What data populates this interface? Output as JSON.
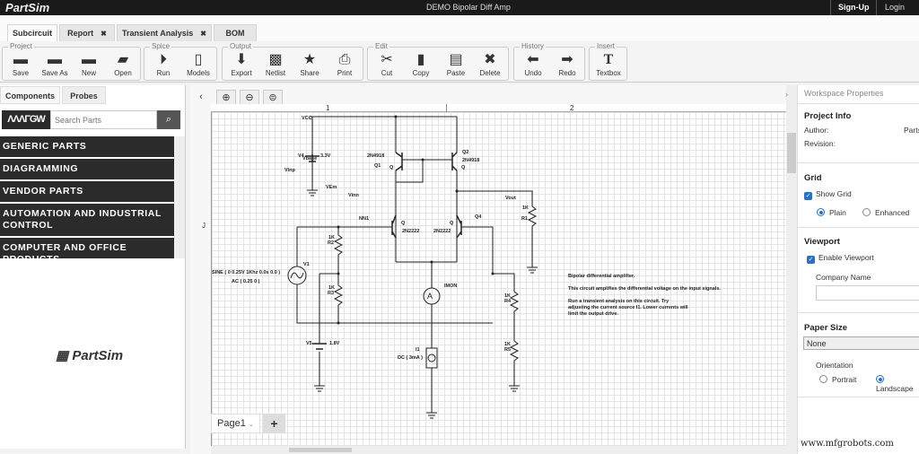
{
  "app": {
    "name": "PartSim",
    "title": "DEMO Bipolar Diff Amp",
    "signup": "Sign-Up",
    "login": "Login"
  },
  "tabs": [
    {
      "label": "Subcircuit",
      "active": true
    },
    {
      "label": "Report",
      "closable": true
    },
    {
      "label": "Transient Analysis",
      "closable": true
    },
    {
      "label": "BOM"
    }
  ],
  "toolbar": {
    "groups": [
      {
        "label": "Project",
        "items": [
          {
            "label": "Save",
            "icon": "folder-icon"
          },
          {
            "label": "Save As",
            "icon": "folder-save-as-icon"
          },
          {
            "label": "New",
            "icon": "folder-new-icon"
          },
          {
            "label": "Open",
            "icon": "folder-open-icon"
          }
        ]
      },
      {
        "label": "Spice",
        "items": [
          {
            "label": "Run",
            "icon": "play-icon"
          },
          {
            "label": "Models",
            "icon": "document-icon"
          }
        ]
      },
      {
        "label": "Output",
        "items": [
          {
            "label": "Export",
            "icon": "arrow-down-icon"
          },
          {
            "label": "Netlist",
            "icon": "netlist-icon"
          },
          {
            "label": "Share",
            "icon": "star-icon"
          },
          {
            "label": "Print",
            "icon": "printer-icon"
          }
        ]
      },
      {
        "label": "Edit",
        "items": [
          {
            "label": "Cut",
            "icon": "scissors-icon"
          },
          {
            "label": "Copy",
            "icon": "copy-icon"
          },
          {
            "label": "Paste",
            "icon": "clipboard-icon"
          },
          {
            "label": "Delete",
            "icon": "x-icon"
          }
        ]
      },
      {
        "label": "History",
        "items": [
          {
            "label": "Undo",
            "icon": "arrow-left-icon"
          },
          {
            "label": "Redo",
            "icon": "arrow-right-icon"
          }
        ]
      },
      {
        "label": "Insert",
        "items": [
          {
            "label": "Textbox",
            "icon": "textbox-icon"
          }
        ]
      }
    ]
  },
  "left": {
    "tabs": [
      "Components",
      "Probes"
    ],
    "brand": "ΛΛΛΓGW",
    "search_placeholder": "Search Parts",
    "categories": [
      "GENERIC PARTS",
      "DIAGRAMMING",
      "VENDOR PARTS",
      "AUTOMATION AND INDUSTRIAL CONTROL",
      "COMPUTER AND OFFICE PRODUCTS"
    ],
    "logo": "PartSim"
  },
  "canvas": {
    "ruler": [
      "1",
      "2"
    ],
    "row_label": "J",
    "page": "Page1",
    "add": "+",
    "labels": {
      "vcc": "VCC",
      "v4": "V4",
      "vbase": "Vbase",
      "v33": "3.3V",
      "vinp": "Vinp",
      "vem": "VEm",
      "vinn": "Vinn",
      "q1n": "2N4918",
      "q1": "Q1",
      "q1q": "Q",
      "q2": "Q2",
      "q2n": "2N4918",
      "q2q": "Q",
      "vout": "Vout",
      "r1v": "1K",
      "r1": "R1",
      "nn": "NN1",
      "q3q": "Q",
      "q3n": "2N2222",
      "q4q": "Q",
      "q4n": "2N2222",
      "q4": "Q4",
      "r2v": "1K",
      "r2": "R2",
      "v1": "V1",
      "sine": "SINE ( 0 0.25V 1Khz 0.0s 0.0 )",
      "ac": "AC ( 0.25 0 )",
      "r3v": "1K",
      "r3": "R3",
      "imon": "IMON",
      "r4v": "1K",
      "r4": "R4",
      "r5v": "1K",
      "r5": "R5",
      "v5": "V5",
      "v18": "1.8V",
      "i1": "I1",
      "dc": "DC ( 3mA )"
    },
    "note": {
      "title": "Bipolar differential amplifier.",
      "line1": "This circuit amplifies the differential voltage on the input signals.",
      "line2": "Run a transient analysis on this circuit. Try",
      "line3": "adjusting the current source I1. Lower currents will",
      "line4": "limit the output drive."
    }
  },
  "right": {
    "header": "Workspace Properties",
    "project_info": "Project Info",
    "author_label": "Author:",
    "author": "Parts",
    "revision_label": "Revision:",
    "grid": "Grid",
    "show_grid": "Show Grid",
    "plain": "Plain",
    "enhanced": "Enhanced",
    "viewport": "Viewport",
    "enable_viewport": "Enable Viewport",
    "company_label": "Company Name",
    "paper_size": "Paper Size",
    "paper_value": "None",
    "orientation": "Orientation",
    "portrait": "Portrait",
    "landscape": "Landscape"
  },
  "watermark": "www.mfgrobots.com"
}
